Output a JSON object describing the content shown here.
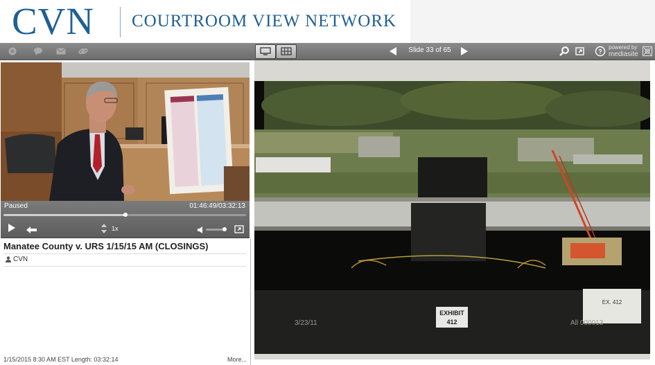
{
  "header": {
    "logo_short": "CVN",
    "logo_full": "COURTROOM VIEW NETWORK"
  },
  "toolbar": {
    "left_icons": [
      "home-icon",
      "chat-icon",
      "email-icon",
      "link-icon"
    ],
    "view_modes": [
      "slide-view-icon",
      "grid-view-icon"
    ],
    "slide_counter": "Slide 33 of 65",
    "right_icons": [
      "search-icon",
      "popout-icon",
      "help-icon",
      "settings-icon"
    ],
    "powered_by": "powered by",
    "powered_brand": "mediasite"
  },
  "player": {
    "status": "Paused",
    "time": "01:46:49/03:32:13",
    "progress": 0.503,
    "speed": "1x",
    "volume": 0.9
  },
  "info": {
    "title": "Manatee County v. URS 1/15/15 AM (CLOSINGS)",
    "presenter": "CVN",
    "footer": "1/15/2015   8:30 AM EST   Length: 03:32:14",
    "more": "More..."
  },
  "slide": {
    "exhibit_label": "EXHIBIT",
    "exhibit_number": "412",
    "date_stamp": "3/23/11",
    "bates": "All 000013",
    "sticker_line1": "",
    "sticker_line2": "EX. 412"
  },
  "colors": {
    "brand_blue": "#1f5f93",
    "toolbar_gray": "#7a7a7a",
    "panel_gray": "#6a6a6a"
  }
}
